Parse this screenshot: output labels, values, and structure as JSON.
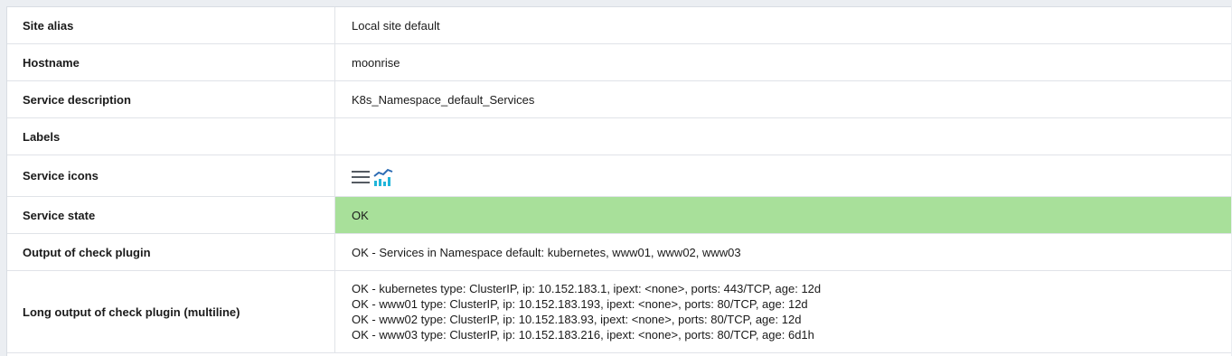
{
  "rows": {
    "site_alias": {
      "label": "Site alias",
      "value": "Local site default"
    },
    "hostname": {
      "label": "Hostname",
      "value": "moonrise"
    },
    "service_description": {
      "label": "Service description",
      "value": "K8s_Namespace_default_Services"
    },
    "labels": {
      "label": "Labels",
      "value": ""
    },
    "service_icons": {
      "label": "Service icons",
      "icons": [
        "menu-icon",
        "graph-icon"
      ]
    },
    "service_state": {
      "label": "Service state",
      "value": "OK",
      "color": "#a8e09a"
    },
    "output": {
      "label": "Output of check plugin",
      "value": "OK - Services in Namespace default: kubernetes, www01, www02, www03"
    },
    "long_output": {
      "label": "Long output of check plugin (multiline)",
      "lines": [
        "OK - kubernetes type: ClusterIP, ip: 10.152.183.1, ipext: <none>, ports: 443/TCP, age: 12d",
        "OK - www01 type: ClusterIP, ip: 10.152.183.193, ipext: <none>, ports: 80/TCP, age: 12d",
        "OK - www02 type: ClusterIP, ip: 10.152.183.93, ipext: <none>, ports: 80/TCP, age: 12d",
        "OK - www03 type: ClusterIP, ip: 10.152.183.216, ipext: <none>, ports: 80/TCP, age: 6d1h"
      ]
    }
  }
}
